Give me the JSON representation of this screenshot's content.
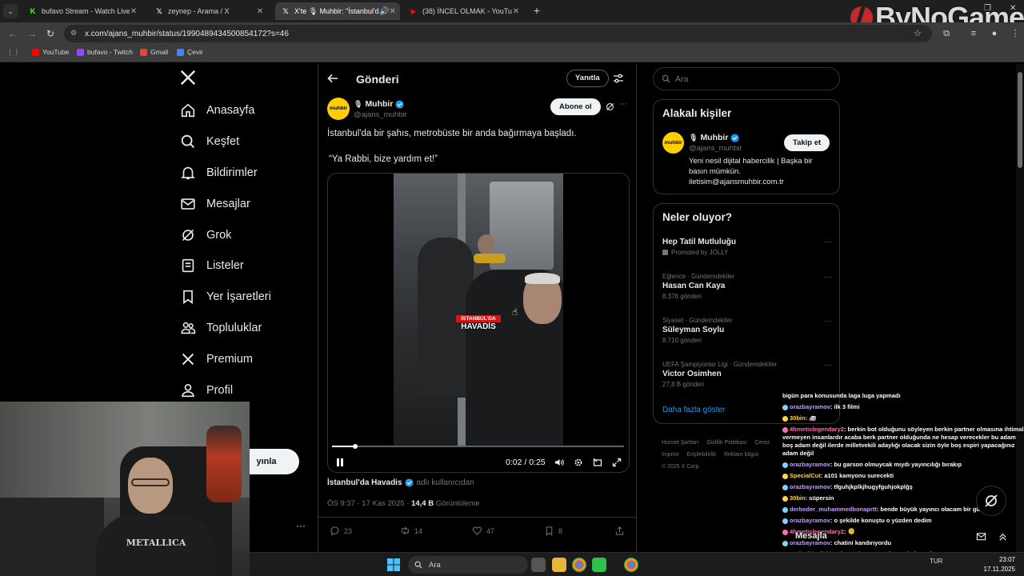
{
  "browser": {
    "tabs": [
      {
        "title": "bufavo Stream - Watch Live on",
        "favicon": "kick-icon",
        "color": "#53fc18",
        "active": false
      },
      {
        "title": "zeynep - Arama / X",
        "favicon": "x-icon",
        "color": "#ffffff",
        "active": false
      },
      {
        "title": "X'te 🎙 Muhbir: \"İstanbul'd",
        "favicon": "x-icon",
        "color": "#ffffff",
        "active": true
      },
      {
        "title": "(38) İNCEL OLMAK - YouTube",
        "favicon": "youtube-icon",
        "color": "#ff0000",
        "active": false
      }
    ],
    "url": "x.com/ajans_muhbir/status/1990489434500854172?s=46",
    "bookmarks": [
      {
        "label": "YouTube",
        "color": "#ff0000"
      },
      {
        "label": "bufavo - Twitch",
        "color": "#9146ff"
      },
      {
        "label": "Gmail",
        "color": "#ea4335"
      },
      {
        "label": "Çevir",
        "color": "#4285f4"
      }
    ]
  },
  "overlay_logo": {
    "prefix": "ByNo",
    "suffix": "Game"
  },
  "nav": {
    "items": [
      {
        "label": "Anasayfa",
        "icon": "home-icon"
      },
      {
        "label": "Keşfet",
        "icon": "search-icon"
      },
      {
        "label": "Bildirimler",
        "icon": "bell-icon"
      },
      {
        "label": "Mesajlar",
        "icon": "mail-icon"
      },
      {
        "label": "Grok",
        "icon": "grok-icon"
      },
      {
        "label": "Listeler",
        "icon": "list-icon"
      },
      {
        "label": "Yer İşaretleri",
        "icon": "bookmark-icon"
      },
      {
        "label": "Topluluklar",
        "icon": "communities-icon"
      },
      {
        "label": "Premium",
        "icon": "x-premium-icon"
      },
      {
        "label": "Profil",
        "icon": "profile-icon"
      },
      {
        "label": "la",
        "icon": "more-icon"
      }
    ],
    "post_button": "yınla",
    "more_dots": "···"
  },
  "main": {
    "title": "Gönderi",
    "reply_button": "Yanıtla",
    "author": {
      "avatar_text": "muhbir",
      "name": "Muhbir",
      "handle": "@ajans_muhbir"
    },
    "subscribe_button": "Abone ol",
    "text_lines": [
      "İstanbul'da bir şahıs, metrobüste bir anda bağırmaya başladı.",
      "“Ya Rabbi, bize yardım et!”"
    ],
    "video": {
      "badge_top": "İSTANBUL'DA",
      "badge_bottom": "HAVADİS",
      "time": "0:02 / 0:25",
      "progress": 0.08
    },
    "source": {
      "name": "İstanbul'da Havadis",
      "sub": "adlı kullanıcıdan"
    },
    "meta": {
      "time": "ÖS 9:37 · 17 Kas 2025 · ",
      "views": "14,4 B",
      "views_label": " Görüntüleme"
    },
    "actions": {
      "replies": "23",
      "reposts": "14",
      "likes": "47",
      "bookmarks": "8"
    }
  },
  "sidebar": {
    "search_placeholder": "Ara",
    "relevant_title": "Alakalı kişiler",
    "relevant_person": {
      "avatar_text": "muhbir",
      "name": "Muhbir",
      "handle": "@ajans_muhbir",
      "follow_button": "Takip et",
      "bio": "Yeni nesil dijital habercilik | Başka bir basın mümkün. iletisim@ajansmuhbir.com.tr"
    },
    "trends_title": "Neler oluyor?",
    "trends": [
      {
        "category": "",
        "name": "Hep Tatil Mutluluğu",
        "count": "Promoted by JOLLY",
        "promoted": true
      },
      {
        "category": "Eğlence · Gündemdekiler",
        "name": "Hasan Can Kaya",
        "count": "8.376 gönderi",
        "promoted": false
      },
      {
        "category": "Siyaset · Gündemdekiler",
        "name": "Süleyman Soylu",
        "count": "8.710 gönderi",
        "promoted": false
      },
      {
        "category": "UEFA Şampiyonlar Ligi · Gündemdekiler",
        "name": "Victor Osimhen",
        "count": "27,8 B gönderi",
        "promoted": false
      }
    ],
    "show_more": "Daha fazla göster",
    "footer": {
      "line1": [
        "Hizmet Şartları",
        "Gizlilik Politikası",
        "Çerez"
      ],
      "line2": [
        "Imprint",
        "Erişilebilirlik",
        "Reklam bilgisi"
      ],
      "line3": "© 2025 X Corp."
    }
  },
  "chat": [
    {
      "user": "",
      "text": "bigün para konusunda laga luga yapmadı",
      "style": ""
    },
    {
      "user": "orazbayramov",
      "text": ": ilk 3 filmi",
      "style": ""
    },
    {
      "user": "30bin",
      "text": ": 🚑",
      "style": "gold"
    },
    {
      "user": "4hmetislegendary2",
      "text": ": berkin bot olduğunu söyleyen berkin partner olmasına ihtimal vermeyen insanlardır acaba berk partner olduğunda ne hesap verecekler bu adam boş adam değil ilerde milletvekili adaylığı olacak sizin öyle boş espiri yapacağınız adam değil",
      "style": "pink"
    },
    {
      "user": "orazbayramov",
      "text": ": bu garson olmuycak mıydı yayıncılığı bırakıp",
      "style": ""
    },
    {
      "user": "SpecialCut",
      "text": ": a101 kamyonu surecekti",
      "style": "gold"
    },
    {
      "user": "orazbayramov",
      "text": ": tfguhjkplkjhugyfguhjokplğş",
      "style": ""
    },
    {
      "user": "30bin",
      "text": ": süpersin",
      "style": "gold"
    },
    {
      "user": "derbeder_muhammedbonaprtt",
      "text": ": bende büyük yayıncı olacam bir gün",
      "style": ""
    },
    {
      "user": "orazbayramov",
      "text": ": o şekilde konuştu o yüzden dedim",
      "style": ""
    },
    {
      "user": "4hmetislegendary2",
      "text": ": 🫠",
      "style": "pink"
    },
    {
      "user": "orazbayramov",
      "text": ": chatini kandırıyordu",
      "style": ""
    },
    {
      "user": "Fatihsikkofield",
      "text": ": rahata alışmış pembe götlü insanlar sürüsü",
      "style": ""
    }
  ],
  "message_drawer": {
    "label": "Mesajla"
  },
  "webcam": {
    "shirt_text": "METALLICA"
  },
  "taskbar": {
    "search_text": "Ara",
    "tray_lang": "TUR",
    "time": "23:07",
    "date": "17.11.2025"
  },
  "colors": {
    "accent": "#1d9bf0",
    "verified": "#1d9bf0",
    "muhbir_yellow": "#ffce00",
    "havadis_red": "#d01818"
  }
}
